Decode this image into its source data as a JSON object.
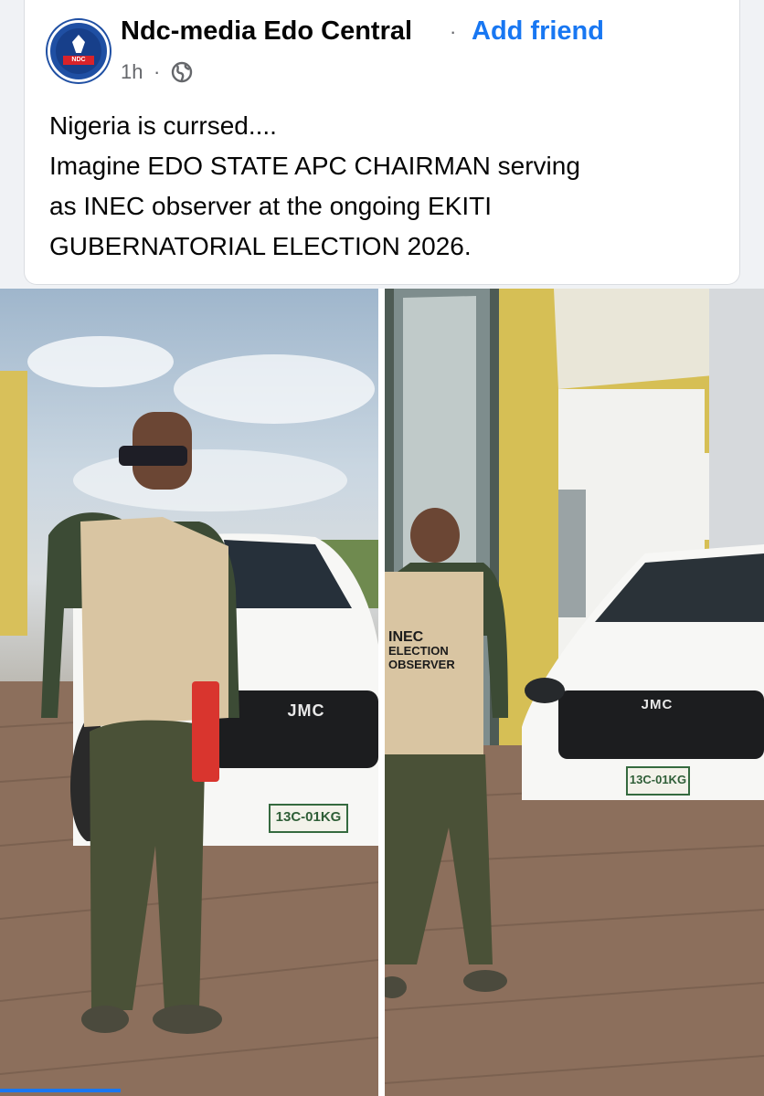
{
  "post": {
    "page_name": "Ndc-media Edo Central",
    "separator": "·",
    "add_friend_label": "Add friend",
    "time": "1h",
    "time_separator": "·",
    "privacy_icon": "globe-icon",
    "avatar_text": "NDC",
    "text_lines": [
      "Nigeria is currsed....",
      "Imagine EDO STATE APC CHAIRMAN serving",
      "as INEC observer at the ongoing EKITI",
      "GUBERNATORIAL ELECTION 2026."
    ]
  },
  "photos": {
    "left": {
      "vest_text": [],
      "grille_brand": "JMC",
      "plate": "13C-01KG"
    },
    "right": {
      "vest_text": [
        "INEC",
        "ELECTION",
        "OBSERVER"
      ],
      "grille_brand": "JMC",
      "plate": "13C-01KG"
    }
  },
  "colors": {
    "link_blue": "#1877f2",
    "text_dark": "#050505",
    "meta_gray": "#65676b",
    "ndc_red": "#d8232a",
    "ndc_blue": "#1f4fa3"
  }
}
